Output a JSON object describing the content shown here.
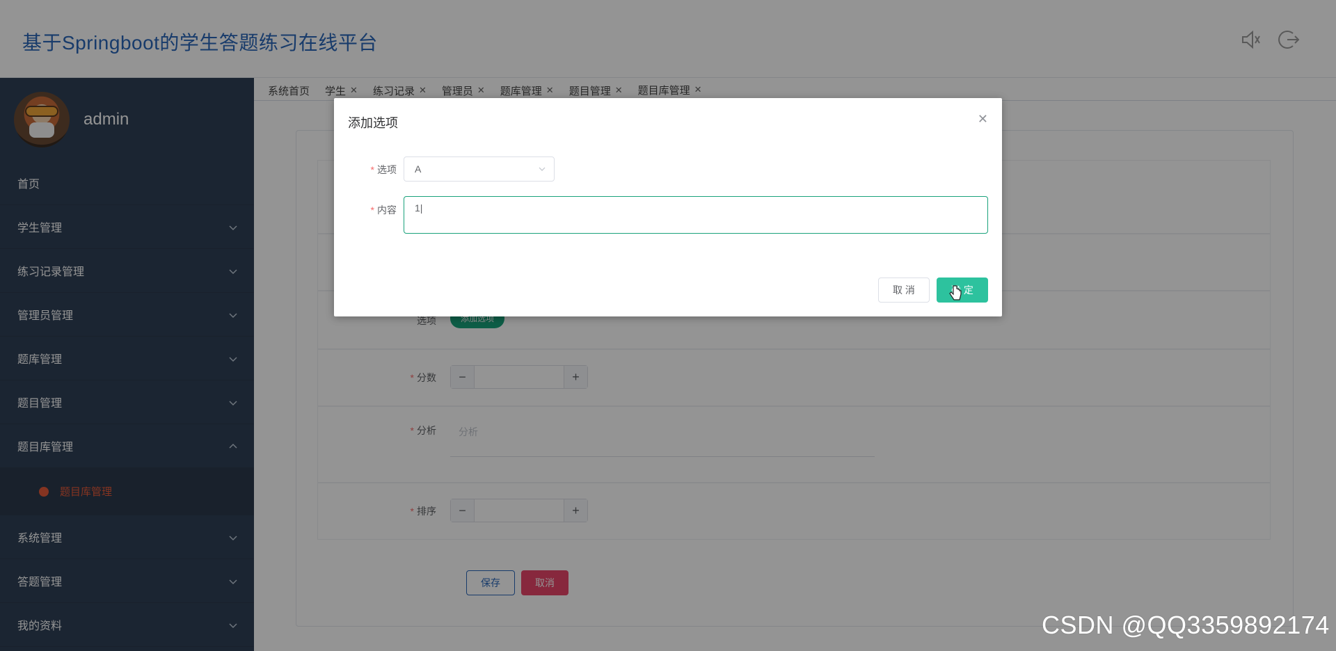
{
  "header": {
    "title": "基于Springboot的学生答题练习在线平台",
    "icons": [
      "speaker-icon",
      "logout-icon"
    ]
  },
  "sidebar": {
    "username": "admin",
    "items": [
      {
        "label": "首页"
      },
      {
        "label": "学生管理"
      },
      {
        "label": "练习记录管理"
      },
      {
        "label": "管理员管理"
      },
      {
        "label": "题库管理"
      },
      {
        "label": "题目管理"
      },
      {
        "label": "题目库管理"
      },
      {
        "label": "系统管理"
      },
      {
        "label": "答题管理"
      },
      {
        "label": "我的资料"
      }
    ],
    "active_sub": "题目库管理"
  },
  "tabs": [
    {
      "label": "系统首页"
    },
    {
      "label": "学生"
    },
    {
      "label": "练习记录"
    },
    {
      "label": "管理员"
    },
    {
      "label": "题库管理"
    },
    {
      "label": "题目管理"
    },
    {
      "label": "题目库管理"
    }
  ],
  "form": {
    "option_label": "选项",
    "add_option_button": "添加选项",
    "score_label": "分数",
    "analysis_label": "分析",
    "analysis_placeholder": "分析",
    "sort_label": "排序",
    "save_button": "保存",
    "cancel_button": "取消"
  },
  "dialog": {
    "title": "添加选项",
    "option_label": "选项",
    "option_value": "A",
    "content_label": "内容",
    "content_value": "1|",
    "cancel_button": "取 消",
    "ok_button": "确 定"
  },
  "watermark": "CSDN @QQ3359892174",
  "colors": {
    "title_blue": "#2a67b8",
    "sidebar_bg": "#304156",
    "primary_green": "#2dc29e",
    "danger_pink": "#e8466a"
  }
}
